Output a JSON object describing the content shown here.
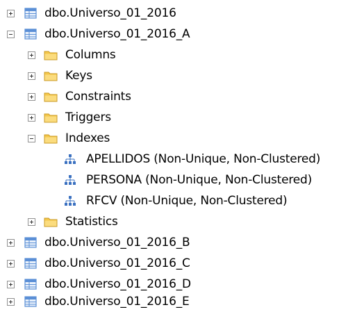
{
  "tree": {
    "items": [
      {
        "label": "dbo.Universo_01_2016",
        "icon": "table-icon",
        "expanded": false
      },
      {
        "label": "dbo.Universo_01_2016_A",
        "icon": "table-icon",
        "expanded": true
      },
      {
        "label": "Columns",
        "icon": "folder-icon",
        "expanded": false
      },
      {
        "label": "Keys",
        "icon": "folder-icon",
        "expanded": false
      },
      {
        "label": "Constraints",
        "icon": "folder-icon",
        "expanded": false
      },
      {
        "label": "Triggers",
        "icon": "folder-icon",
        "expanded": false
      },
      {
        "label": "Indexes",
        "icon": "folder-icon",
        "expanded": true
      },
      {
        "label": "APELLIDOS (Non-Unique, Non-Clustered)",
        "icon": "index-icon"
      },
      {
        "label": "PERSONA (Non-Unique, Non-Clustered)",
        "icon": "index-icon"
      },
      {
        "label": "RFCV (Non-Unique, Non-Clustered)",
        "icon": "index-icon"
      },
      {
        "label": "Statistics",
        "icon": "folder-icon",
        "expanded": false
      },
      {
        "label": "dbo.Universo_01_2016_B",
        "icon": "table-icon",
        "expanded": false
      },
      {
        "label": "dbo.Universo_01_2016_C",
        "icon": "table-icon",
        "expanded": false
      },
      {
        "label": "dbo.Universo_01_2016_D",
        "icon": "table-icon",
        "expanded": false
      },
      {
        "label": "dbo.Universo_01_2016_E",
        "icon": "table-icon",
        "expanded": false
      }
    ]
  },
  "colors": {
    "text": "#000000",
    "expander_border": "#919191",
    "folder": "#f4c74b",
    "table_icon": "#5b8fd6",
    "index_icon": "#3a70c0"
  }
}
